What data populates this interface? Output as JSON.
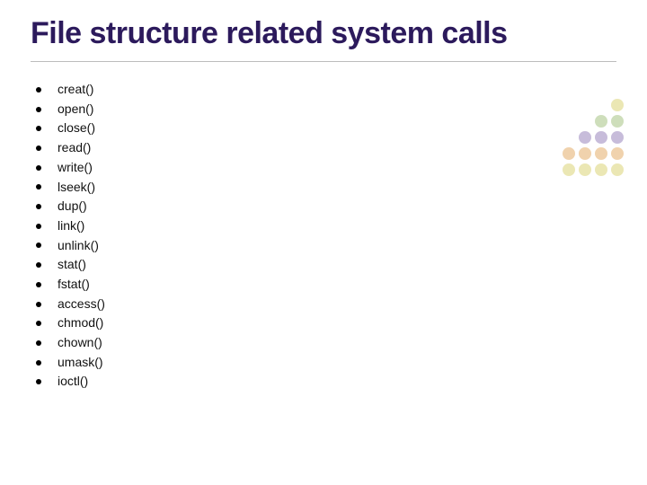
{
  "title": "File structure related system calls",
  "items": [
    "creat()",
    "open()",
    "close()",
    "read()",
    "write()",
    "lseek()",
    "dup()",
    "link()",
    "unlink()",
    "stat()",
    "fstat()",
    "access()",
    "chmod()",
    "chown()",
    "umask()",
    "ioctl()"
  ]
}
